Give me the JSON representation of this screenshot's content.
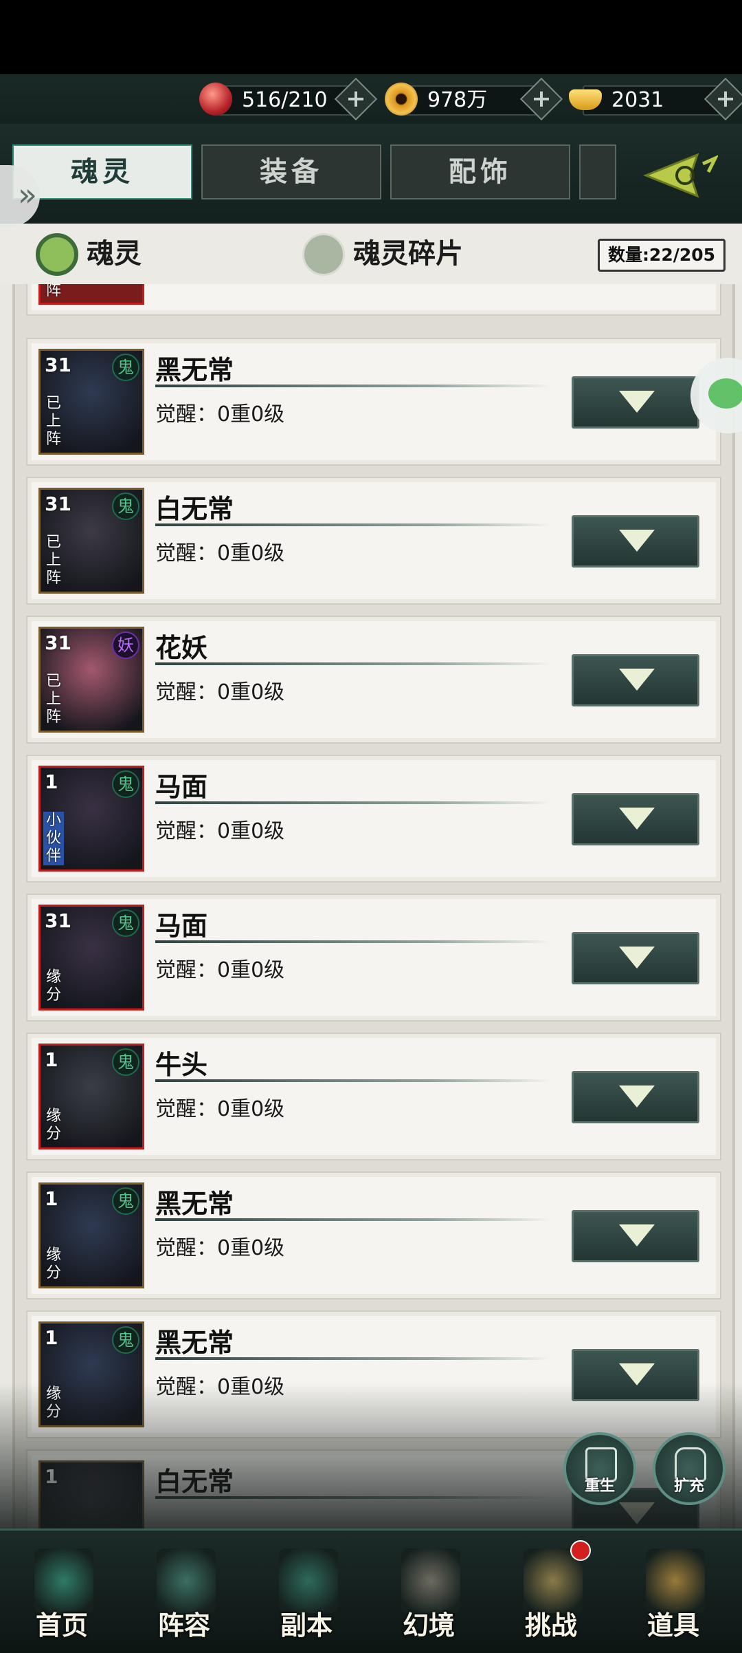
{
  "resources": [
    {
      "icon": "red-orb-icon",
      "value": "516/210"
    },
    {
      "icon": "gold-coin-icon",
      "value": "978万"
    },
    {
      "icon": "gold-ingot-icon",
      "value": "2031"
    }
  ],
  "tabs": [
    {
      "label": "魂灵",
      "active": true
    },
    {
      "label": "装备",
      "active": false
    },
    {
      "label": "配饰",
      "active": false
    },
    {
      "label": "",
      "active": false
    }
  ],
  "filters": [
    {
      "label": "魂灵",
      "selected": true
    },
    {
      "label": "魂灵碎片",
      "selected": false
    }
  ],
  "count_label": "数量:22/205",
  "partial_top_item": {
    "tag": "阵"
  },
  "cards": [
    {
      "level": "31",
      "name": "黑无常",
      "awaken": "觉醒：0重0级",
      "tag": "已上阵",
      "type": "鬼",
      "frame": "bronze",
      "tag_color": "none",
      "art": "#2f3a52"
    },
    {
      "level": "31",
      "name": "白无常",
      "awaken": "觉醒：0重0级",
      "tag": "已上阵",
      "type": "鬼",
      "frame": "bronze",
      "tag_color": "none",
      "art": "#3d3a44"
    },
    {
      "level": "31",
      "name": "花妖",
      "awaken": "觉醒：0重0级",
      "tag": "已上阵",
      "type": "妖",
      "frame": "bronze",
      "tag_color": "none",
      "art": "#a4586e"
    },
    {
      "level": "1",
      "name": "马面",
      "awaken": "觉醒：0重0级",
      "tag": "小伙伴",
      "type": "鬼",
      "frame": "red",
      "tag_color": "blue",
      "art": "#3a3144"
    },
    {
      "level": "31",
      "name": "马面",
      "awaken": "觉醒：0重0级",
      "tag": "缘分",
      "type": "鬼",
      "frame": "red",
      "tag_color": "none",
      "art": "#3a3144"
    },
    {
      "level": "1",
      "name": "牛头",
      "awaken": "觉醒：0重0级",
      "tag": "缘分",
      "type": "鬼",
      "frame": "red",
      "tag_color": "none",
      "art": "#3a3e44"
    },
    {
      "level": "1",
      "name": "黑无常",
      "awaken": "觉醒：0重0级",
      "tag": "缘分",
      "type": "鬼",
      "frame": "bronze",
      "tag_color": "none",
      "art": "#2f3a52"
    },
    {
      "level": "1",
      "name": "黑无常",
      "awaken": "觉醒：0重0级",
      "tag": "缘分",
      "type": "鬼",
      "frame": "bronze",
      "tag_color": "none",
      "art": "#2f3a52"
    },
    {
      "level": "1",
      "name": "白无常",
      "awaken": "",
      "tag": "",
      "type": "",
      "frame": "bronze",
      "tag_color": "none",
      "art": "#3d3a44"
    }
  ],
  "float_buttons": [
    {
      "label": "重生",
      "icon": "rebirth-icon"
    },
    {
      "label": "扩充",
      "icon": "expand-bag-icon"
    }
  ],
  "nav": [
    {
      "label": "首页",
      "icon": "home-palace-icon",
      "badge": false,
      "color": "#2f7a66"
    },
    {
      "label": "阵容",
      "icon": "lineup-books-icon",
      "badge": false,
      "color": "#3b6f63"
    },
    {
      "label": "副本",
      "icon": "dungeon-sword-icon",
      "badge": false,
      "color": "#2e6a5c"
    },
    {
      "label": "幻境",
      "icon": "crossed-swords-icon",
      "badge": false,
      "color": "#6d6a60"
    },
    {
      "label": "挑战",
      "icon": "challenge-scroll-icon",
      "badge": true,
      "color": "#8a7a4a"
    },
    {
      "label": "道具",
      "icon": "item-bag-icon",
      "badge": false,
      "color": "#9a7a3a"
    }
  ]
}
